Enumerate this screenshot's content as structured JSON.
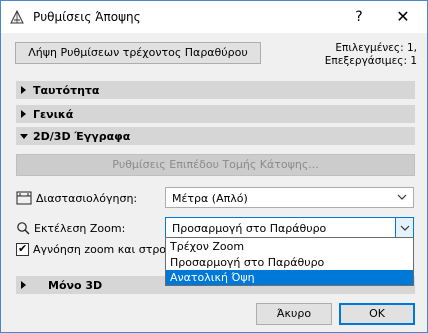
{
  "window": {
    "title": "Ρυθμίσεις Άποψης",
    "help": "?",
    "close": "✕"
  },
  "top": {
    "get_settings_button": "Λήψη Ρυθμίσεων τρέχοντος Παραθύρου",
    "selected_label": "Επιλεγμένες: 1,",
    "editable_label": "Επεξεργάσιμες: 1"
  },
  "sections": {
    "identity": "Ταυτότητα",
    "general": "Γενικά",
    "docs_2d3d": "2D/3D Έγγραφα",
    "only_3d": "Μόνο 3D"
  },
  "docs": {
    "section_plan_button": "Ρυθμίσεις Επιπέδου Τομής Κάτοψης...",
    "dimension_label": "Διαστασιολόγηση:",
    "dimension_value": "Μέτρα (Απλό)",
    "zoom_label": "Εκτέλεση Zoom:",
    "zoom_value": "Προσαρμογή στο Παράθυρο",
    "ignore_zoom_label": "Αγνόηση zoom και στροφ",
    "zoom_options": [
      "Τρέχον Zoom",
      "Προσαρμογή στο Παράθυρο",
      "Ανατολική Όψη"
    ],
    "zoom_highlighted_index": 2
  },
  "footer": {
    "cancel": "Άκυρο",
    "ok": "OK"
  },
  "colors": {
    "accent": "#0078d7",
    "header_bg": "#d6d6d6",
    "window_border": "#4a86c8"
  }
}
